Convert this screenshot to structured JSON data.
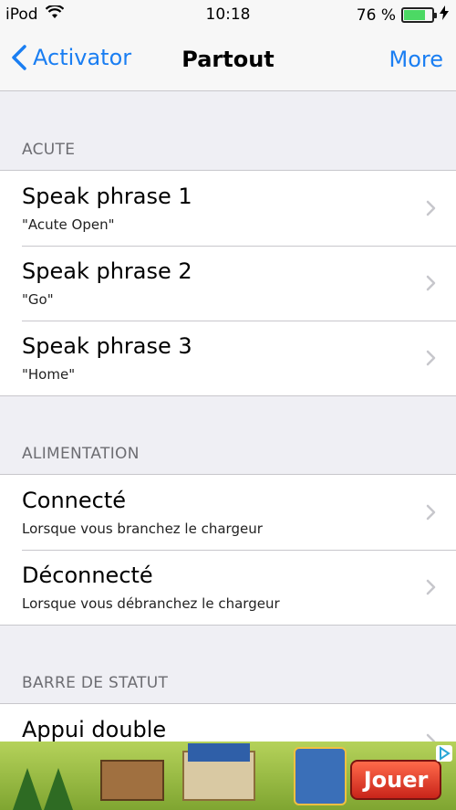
{
  "status_bar": {
    "device": "iPod",
    "time": "10:18",
    "battery": "76 %",
    "battery_level": 0.76
  },
  "nav": {
    "back_label": "Activator",
    "title": "Partout",
    "more_label": "More"
  },
  "sections": [
    {
      "header": "ACUTE",
      "rows": [
        {
          "title": "Speak phrase 1",
          "subtitle": "\"Acute Open\""
        },
        {
          "title": "Speak phrase 2",
          "subtitle": "\"Go\""
        },
        {
          "title": "Speak phrase 3",
          "subtitle": "\"Home\""
        }
      ]
    },
    {
      "header": "ALIMENTATION",
      "rows": [
        {
          "title": "Connecté",
          "subtitle": "Lorsque vous branchez le chargeur"
        },
        {
          "title": "Déconnecté",
          "subtitle": "Lorsque vous débranchez le chargeur"
        }
      ]
    },
    {
      "header": "BARRE DE STATUT",
      "rows": [
        {
          "title": "Appui double",
          "subtitle": ""
        }
      ]
    }
  ],
  "ad": {
    "cta_label": "Jouer"
  },
  "colors": {
    "accent": "#1a7ef2",
    "battery_fill": "#4cd964"
  }
}
